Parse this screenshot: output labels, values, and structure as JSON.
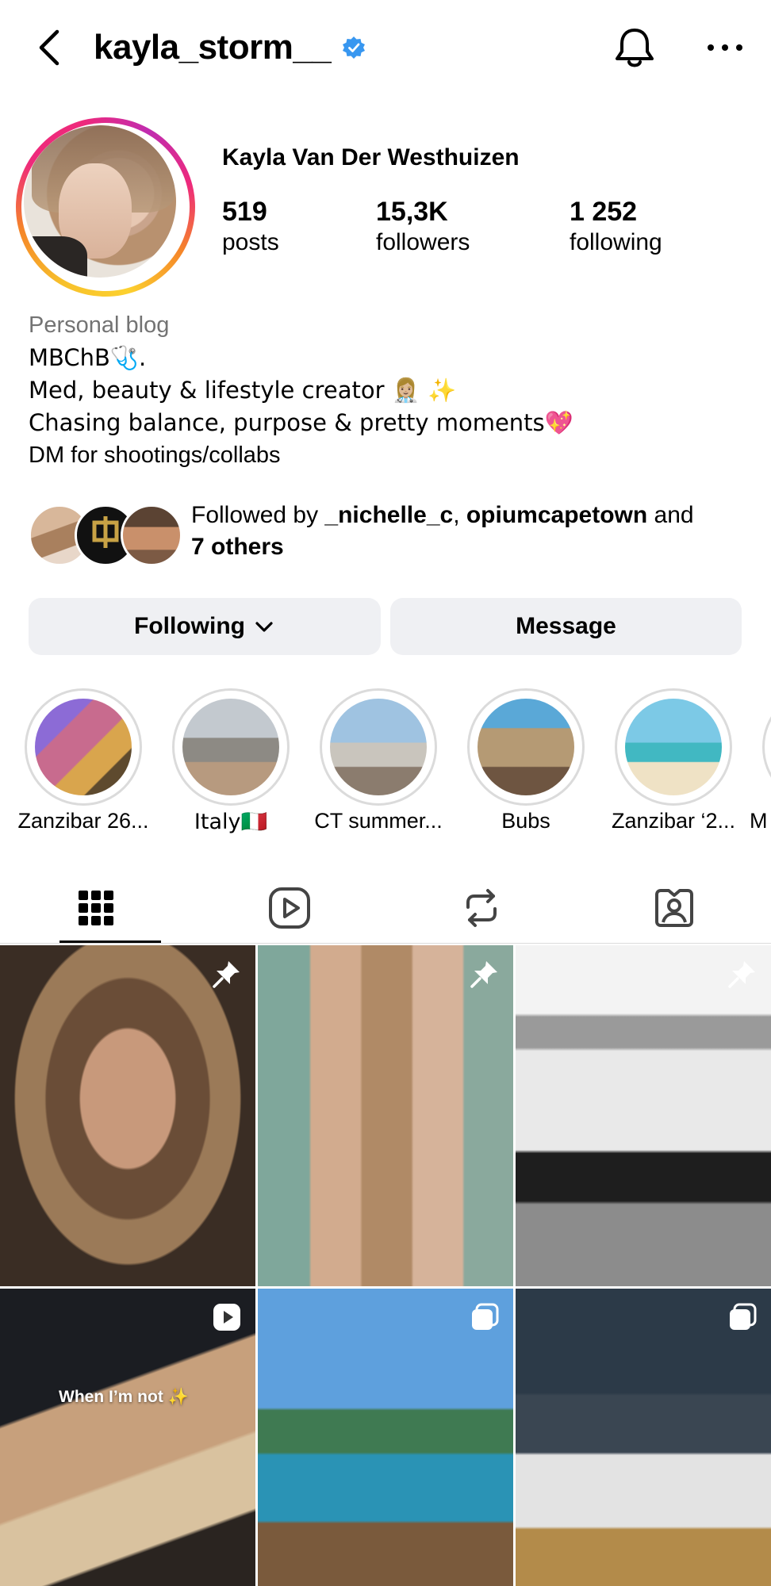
{
  "header": {
    "username": "kayla_storm__"
  },
  "profile": {
    "full_name": "Kayla Van Der Westhuizen",
    "stats": [
      {
        "value": "519",
        "label": "posts"
      },
      {
        "value": "15,3K",
        "label": "followers"
      },
      {
        "value": "1 252",
        "label": "following"
      }
    ],
    "category": "Personal blog",
    "bio_lines": [
      "MBChB🩺.",
      "Med, beauty & lifestyle creator 👩🏼‍⚕️ ✨",
      "Chasing balance, purpose & pretty moments💖",
      "DM for shootings/collabs"
    ]
  },
  "followed_by": {
    "prefix": "Followed by ",
    "user1": "_nichelle_c",
    "sep": ", ",
    "user2": "opiumcapetown",
    "and": " and",
    "others": "7 others"
  },
  "buttons": {
    "following": "Following",
    "message": "Message"
  },
  "highlights": [
    {
      "label": "Zanzibar 26..."
    },
    {
      "label": "Italy🇮🇹"
    },
    {
      "label": "CT summer..."
    },
    {
      "label": "Bubs"
    },
    {
      "label": "Zanzibar ‘2..."
    },
    {
      "label": "M"
    }
  ],
  "tabs": [
    "grid-icon",
    "reels-icon",
    "reposts-icon",
    "tagged-icon"
  ],
  "posts": [
    {
      "badge": "pin-icon"
    },
    {
      "badge": "pin-icon"
    },
    {
      "badge": "pin-icon"
    },
    {
      "badge": "reel-icon",
      "caption": "When I’m not ✨"
    },
    {
      "badge": "carousel-icon"
    },
    {
      "badge": "carousel-icon"
    }
  ],
  "colors": {
    "verified": "#3897f0",
    "button_bg": "#eff0f3",
    "secondary_text": "#737373"
  }
}
